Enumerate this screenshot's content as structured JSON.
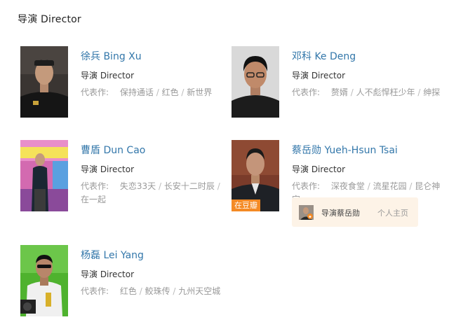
{
  "section_title": "导演 Director",
  "people": [
    {
      "name": "徐兵 Bing Xu",
      "role": "导演 Director",
      "works_label": "代表作:",
      "works": [
        "保持通话",
        "红色",
        "新世界"
      ]
    },
    {
      "name": "邓科 Ke Deng",
      "role": "导演 Director",
      "works_label": "代表作:",
      "works": [
        "赘婿",
        "人不彪悍枉少年",
        "绅探"
      ]
    },
    {
      "name": "曹盾 Dun Cao",
      "role": "导演 Director",
      "works_label": "代表作:",
      "works": [
        "失恋33天",
        "长安十二时辰",
        "在一起"
      ]
    },
    {
      "name": "蔡岳勋 Yueh-Hsun Tsai",
      "role": "导演 Director",
      "works_label": "代表作:",
      "works": [
        "深夜食堂",
        "流星花园",
        "昆仑神宫"
      ],
      "badge": "在豆瓣",
      "profile": {
        "text": "导演蔡岳勋",
        "link": "个人主页"
      }
    },
    {
      "name": "杨磊 Lei Yang",
      "role": "导演 Director",
      "works_label": "代表作:",
      "works": [
        "红色",
        "鲛珠传",
        "九州天空城"
      ]
    }
  ]
}
